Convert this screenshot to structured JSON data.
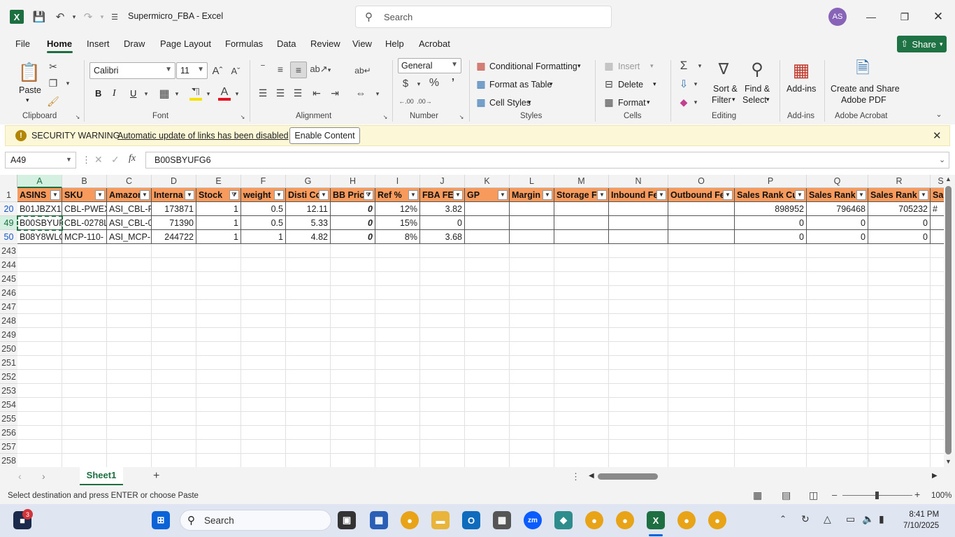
{
  "window": {
    "title": "Supermicro_FBA  -  Excel",
    "search_placeholder": "Search",
    "user_initials": "AS"
  },
  "menu": {
    "tabs": [
      "File",
      "Home",
      "Insert",
      "Draw",
      "Page Layout",
      "Formulas",
      "Data",
      "Review",
      "View",
      "Help",
      "Acrobat"
    ],
    "active": "Home",
    "share_label": "Share"
  },
  "ribbon": {
    "clipboard": {
      "paste": "Paste",
      "group": "Clipboard"
    },
    "font": {
      "name": "Calibri",
      "size": "11",
      "group": "Font",
      "bold": "B",
      "italic": "I",
      "underline": "U"
    },
    "alignment": {
      "group": "Alignment"
    },
    "number": {
      "format": "General",
      "group": "Number"
    },
    "styles": {
      "conditional": "Conditional Formatting",
      "format_table": "Format as Table",
      "cell_styles": "Cell Styles",
      "group": "Styles"
    },
    "cells": {
      "insert": "Insert",
      "delete": "Delete",
      "format": "Format",
      "group": "Cells"
    },
    "editing": {
      "sort_filter_1": "Sort &",
      "sort_filter_2": "Filter",
      "find_select_1": "Find &",
      "find_select_2": "Select",
      "group": "Editing"
    },
    "addins": {
      "label": "Add-ins",
      "group": "Add-ins"
    },
    "acrobat": {
      "label_1": "Create and Share",
      "label_2": "Adobe PDF",
      "group": "Adobe Acrobat"
    }
  },
  "security_bar": {
    "title": "SECURITY WARNING",
    "message": "Automatic update of links has been disabled",
    "button": "Enable Content"
  },
  "formula_bar": {
    "name_box": "A49",
    "fx": "fx",
    "value": "B00SBYUFG6"
  },
  "sheet": {
    "columns": [
      "A",
      "B",
      "C",
      "D",
      "E",
      "F",
      "G",
      "H",
      "I",
      "J",
      "K",
      "L",
      "M",
      "N",
      "O",
      "P",
      "Q",
      "R",
      "S"
    ],
    "headers": [
      "ASINS",
      "SKU",
      "Amazon",
      "Interna",
      "Stock",
      "weight",
      "Disti Co",
      "BB Price",
      "Ref %",
      "FBA FEE",
      "GP",
      "Margin",
      "Storage F",
      "Inbound Fe",
      "Outbound Fe",
      "Sales Rank Cu",
      "Sales Rank",
      "Sales Rank (",
      "Sa"
    ],
    "rows": [
      {
        "num": "20",
        "cells": [
          "B01JBZX1C",
          "CBL-PWEX",
          "ASI_CBL-P",
          "173871",
          "1",
          "0.5",
          "12.11",
          "0",
          "12%",
          "3.82",
          "",
          "",
          "",
          "",
          "",
          "898952",
          "796468",
          "705232",
          "#"
        ]
      },
      {
        "num": "49",
        "cells": [
          "B00SBYUF",
          "CBL-0278L",
          "ASI_CBL-0",
          "71390",
          "1",
          "0.5",
          "5.33",
          "0",
          "15%",
          "0",
          "",
          "",
          "",
          "",
          "",
          "0",
          "0",
          "0",
          ""
        ]
      },
      {
        "num": "50",
        "cells": [
          "B08Y8WLC",
          "MCP-110-",
          "ASI_MCP-",
          "244722",
          "1",
          "1",
          "4.82",
          "0",
          "8%",
          "3.68",
          "",
          "",
          "",
          "",
          "",
          "0",
          "0",
          "0",
          ""
        ]
      }
    ],
    "empty_rows": [
      "243",
      "244",
      "245",
      "246",
      "247",
      "248",
      "249",
      "250",
      "251",
      "252",
      "253",
      "254",
      "255",
      "256",
      "257",
      "258"
    ],
    "header_row_num": "1",
    "tab_name": "Sheet1"
  },
  "status": {
    "message": "Select destination and press ENTER or choose Paste",
    "zoom": "100%"
  },
  "taskbar": {
    "search": "Search",
    "time": "8:41 PM",
    "date": "7/10/2025",
    "badge": "3"
  },
  "colors": {
    "header_fill": "#f79a5c",
    "excel_green": "#1d6f42"
  }
}
